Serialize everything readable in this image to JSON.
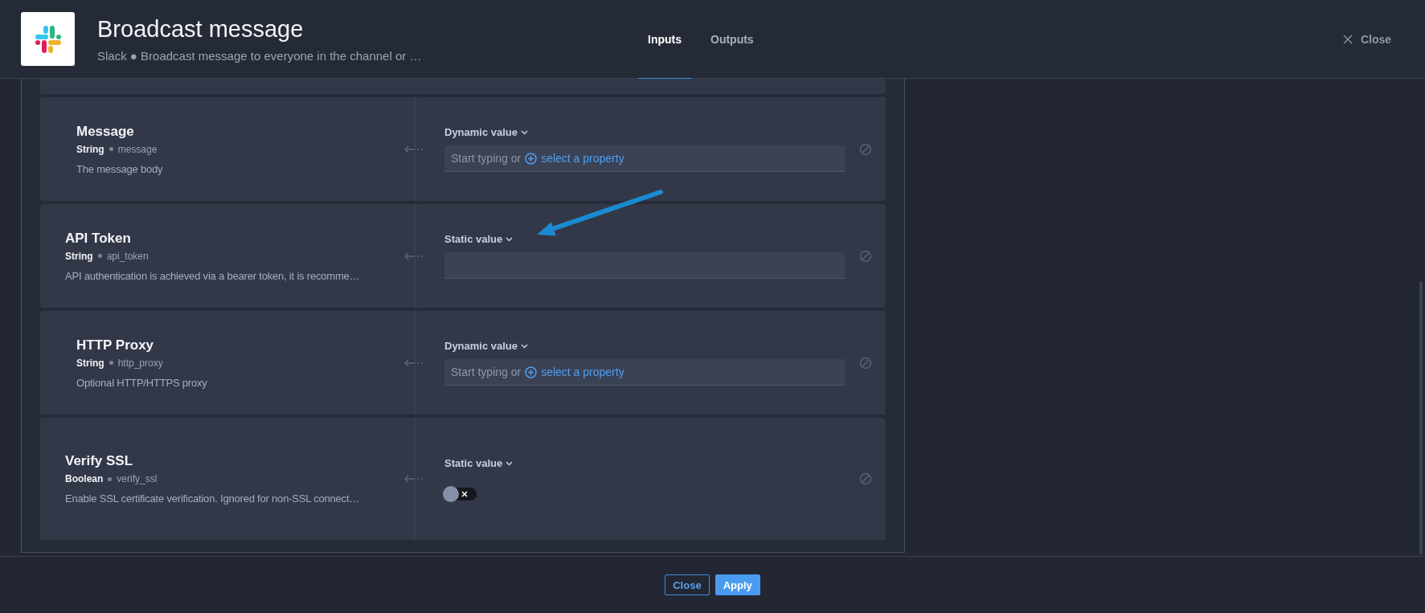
{
  "header": {
    "title": "Broadcast message",
    "subtitle": "Slack ● Broadcast message to everyone in the channel or …",
    "close": "Close"
  },
  "tabs": [
    {
      "label": "Inputs",
      "selected": true
    },
    {
      "label": "Outputs",
      "selected": false
    }
  ],
  "inputs": [
    {
      "name": "Message",
      "type": "String",
      "key": "message",
      "description": "The message body",
      "mode": "Dynamic value",
      "kind": "property",
      "hint": "Start typing or",
      "link": "select a property"
    },
    {
      "name": "API Token",
      "type": "String",
      "key": "api_token",
      "description": "API authentication is achieved via a bearer token, it is recomme…",
      "mode": "Static value",
      "kind": "text"
    },
    {
      "name": "HTTP Proxy",
      "type": "String",
      "key": "http_proxy",
      "description": "Optional HTTP/HTTPS proxy",
      "mode": "Dynamic value",
      "kind": "property",
      "hint": "Start typing or",
      "link": "select a property"
    },
    {
      "name": "Verify SSL",
      "type": "Boolean",
      "key": "verify_ssl",
      "description": "Enable SSL certificate verification. Ignored for non-SSL connect…",
      "mode": "Static value",
      "kind": "toggle",
      "on": false
    }
  ],
  "footer": {
    "buttons": [
      {
        "label": "Close",
        "kind": "secondary"
      },
      {
        "label": "Apply",
        "kind": "primary"
      }
    ]
  }
}
